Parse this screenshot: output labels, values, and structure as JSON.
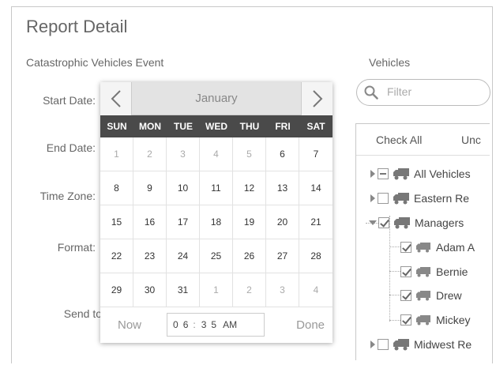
{
  "header": {
    "title": "Report Detail"
  },
  "form": {
    "section_label": "Catastrophic Vehicles Event",
    "start_date_label": "Start Date:",
    "end_date_label": "End Date:",
    "time_zone_label": "Time Zone:",
    "format_label": "Format:",
    "send_to_label": "Send to"
  },
  "date_picker": {
    "month": "January",
    "weekdays": [
      "SUN",
      "MON",
      "TUE",
      "WED",
      "THU",
      "FRI",
      "SAT"
    ],
    "days": [
      [
        "1",
        "2",
        "3",
        "4",
        "5",
        "6",
        "7"
      ],
      [
        "8",
        "9",
        "10",
        "11",
        "12",
        "13",
        "14"
      ],
      [
        "15",
        "16",
        "17",
        "18",
        "19",
        "20",
        "21"
      ],
      [
        "22",
        "23",
        "24",
        "25",
        "26",
        "27",
        "28"
      ],
      [
        "29",
        "30",
        "31",
        "1",
        "2",
        "3",
        "4"
      ]
    ],
    "now_label": "Now",
    "done_label": "Done",
    "time": {
      "h1": "0",
      "h2": "6",
      "m1": "3",
      "m2": "5",
      "ampm": "AM"
    }
  },
  "vehicles": {
    "label": "Vehicles",
    "filter_placeholder": "Filter",
    "check_all": "Check All",
    "uncheck_all": "Unc",
    "groups": [
      {
        "label": "All Vehicles",
        "state": "partial"
      },
      {
        "label": "Eastern Re",
        "state": "unchecked"
      },
      {
        "label": "Managers",
        "state": "checked"
      },
      {
        "label": "Midwest Re",
        "state": "unchecked"
      }
    ],
    "managers": [
      "Adam A",
      "Bernie",
      "Drew",
      "Mickey"
    ]
  },
  "colors": {
    "weekday_bar": "#4a4a4a",
    "header_bg": "#e3e3e3",
    "muted_text": "#aaaaaa"
  }
}
